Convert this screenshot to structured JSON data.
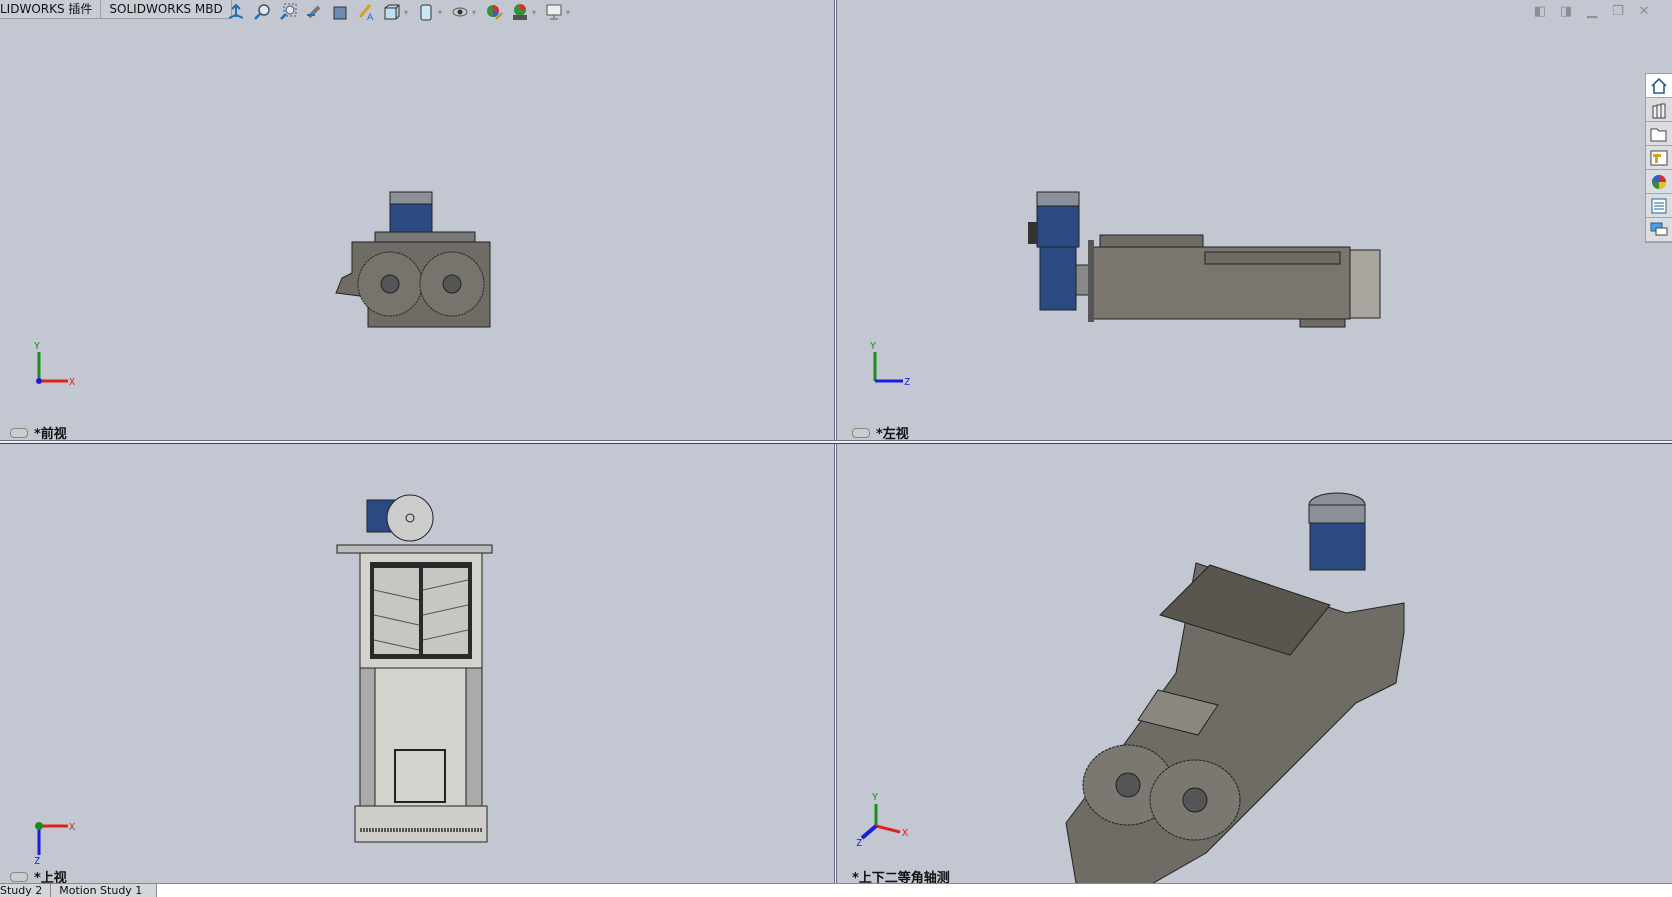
{
  "ribbon_tabs": [
    {
      "label": "LIDWORKS 插件"
    },
    {
      "label": "SOLIDWORKS MBD"
    }
  ],
  "heads_up_toolbar": [
    "view-orientation-icon",
    "zoom-to-fit-icon",
    "zoom-to-area-icon",
    "previous-view-icon",
    "section-view-icon",
    "dynamic-annotation-icon",
    "view-orientation-dropdown-icon",
    "display-style-icon",
    "hide-show-icon",
    "edit-appearance-icon",
    "apply-scene-icon",
    "view-settings-icon"
  ],
  "window_controls": [
    "prev-viewport-icon",
    "next-viewport-icon",
    "minimize-icon",
    "restore-icon",
    "close-icon"
  ],
  "task_pane": [
    "home-icon",
    "design-library-icon",
    "file-explorer-icon",
    "view-palette-icon",
    "appearances-icon",
    "custom-properties-icon",
    "forum-icon"
  ],
  "viewports": {
    "front": {
      "label": "*前视"
    },
    "left": {
      "label": "*左视"
    },
    "top": {
      "label": "*上视"
    },
    "iso": {
      "label": "*上下二等角轴测"
    }
  },
  "axes": {
    "x": "X",
    "y": "Y",
    "z": "Z"
  },
  "bottom_tabs": [
    {
      "label": "Study 2"
    },
    {
      "label": "Motion Study 1"
    }
  ],
  "colors": {
    "viewport_bg": "#c3c7d1",
    "body": "#6f6c66",
    "motor": "#2c4a82",
    "axis_x": "#e02020",
    "axis_y": "#1c8a1c",
    "axis_z": "#1c1ce0"
  }
}
